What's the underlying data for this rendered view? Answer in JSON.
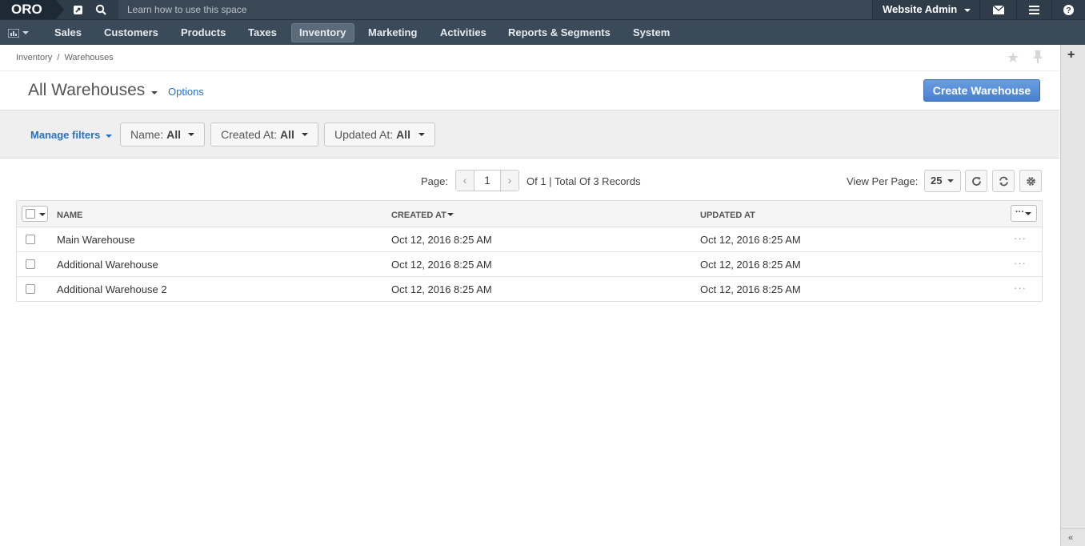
{
  "app": {
    "logo": "ORO",
    "search_placeholder": "Learn how to use this space",
    "user_menu": "Website Admin"
  },
  "nav": {
    "items": [
      "Sales",
      "Customers",
      "Products",
      "Taxes",
      "Inventory",
      "Marketing",
      "Activities",
      "Reports & Segments",
      "System"
    ],
    "active": "Inventory"
  },
  "breadcrumb": {
    "parent": "Inventory",
    "separator": "/",
    "current": "Warehouses"
  },
  "page": {
    "title": "All Warehouses",
    "options_label": "Options",
    "create_button": "Create Warehouse"
  },
  "filters": {
    "manage_label": "Manage filters",
    "items": [
      {
        "label": "Name:",
        "value": "All"
      },
      {
        "label": "Created At:",
        "value": "All"
      },
      {
        "label": "Updated At:",
        "value": "All"
      }
    ]
  },
  "pagination": {
    "page_label": "Page:",
    "current_page": "1",
    "total_text": "Of 1 | Total Of 3 Records",
    "per_page_label": "View Per Page:",
    "per_page_value": "25"
  },
  "grid": {
    "columns": [
      "NAME",
      "CREATED AT",
      "UPDATED AT"
    ],
    "rows": [
      {
        "name": "Main Warehouse",
        "created_at": "Oct 12, 2016 8:25 AM",
        "updated_at": "Oct 12, 2016 8:25 AM"
      },
      {
        "name": "Additional Warehouse",
        "created_at": "Oct 12, 2016 8:25 AM",
        "updated_at": "Oct 12, 2016 8:25 AM"
      },
      {
        "name": "Additional Warehouse 2",
        "created_at": "Oct 12, 2016 8:25 AM",
        "updated_at": "Oct 12, 2016 8:25 AM"
      }
    ],
    "row_actions_label": "···",
    "column_menu_label": "···"
  },
  "colors": {
    "topbar": "#2f3d4a",
    "navbar": "#3b4a58",
    "link": "#2673c4",
    "primary_button": "#4a7fd0"
  }
}
